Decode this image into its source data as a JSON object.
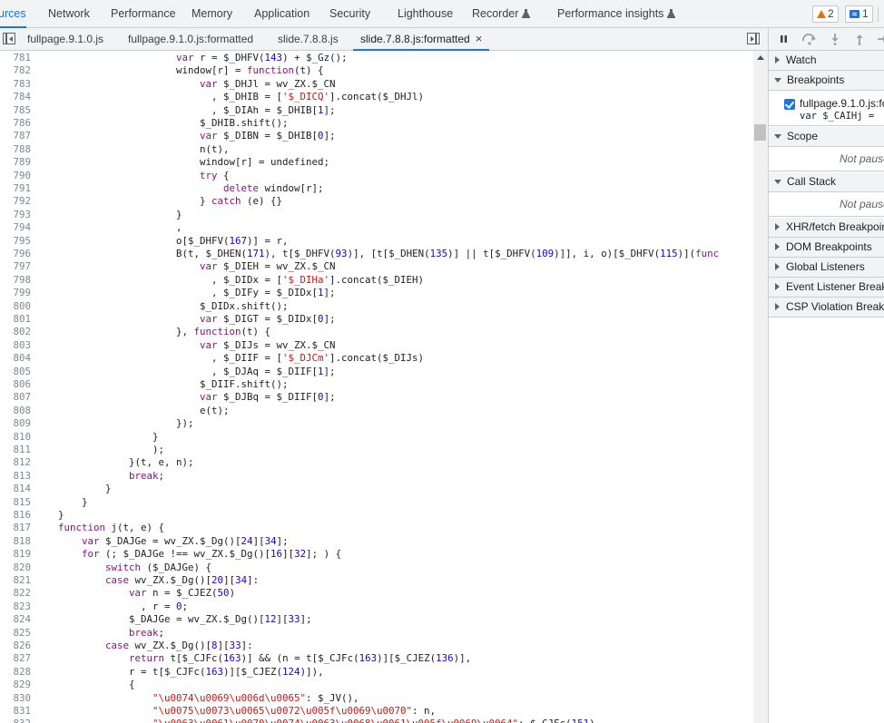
{
  "main_tabs": [
    {
      "label": "urces",
      "active": true
    },
    {
      "label": "Network"
    },
    {
      "label": "Performance"
    },
    {
      "label": "Memory"
    },
    {
      "label": "Application"
    },
    {
      "label": "Security"
    },
    {
      "label": "Lighthouse"
    },
    {
      "label": "Recorder",
      "experimental": true
    },
    {
      "label": "Performance insights",
      "experimental": true
    }
  ],
  "issues": {
    "warnings": "2",
    "messages": "1"
  },
  "file_tabs": [
    {
      "label": "fullpage.9.1.0.js"
    },
    {
      "label": "fullpage.9.1.0.js:formatted"
    },
    {
      "label": "slide.7.8.8.js"
    },
    {
      "label": "slide.7.8.8.js:formatted",
      "active": true,
      "close": "×"
    }
  ],
  "code_lines": [
    {
      "n": "781",
      "h": "                        <span class=\"kw\">var</span> r = $_DHFV(<span class=\"nm\">143</span>) + $_Gz();"
    },
    {
      "n": "782",
      "h": "                        window[r] = <span class=\"kw\">function</span>(t) {"
    },
    {
      "n": "783",
      "h": "                            <span class=\"kw\">var</span> $_DHJl = wv_ZX.$_CN"
    },
    {
      "n": "784",
      "h": "                              , $_DHIB = [<span class=\"st\">'$_DICQ'</span>].concat($_DHJl)"
    },
    {
      "n": "785",
      "h": "                              , $_DIAh = $_DHIB[<span class=\"nm\">1</span>];"
    },
    {
      "n": "786",
      "h": "                            $_DHIB.shift();"
    },
    {
      "n": "787",
      "h": "                            <span class=\"kw\">var</span> $_DIBN = $_DHIB[<span class=\"nm\">0</span>];"
    },
    {
      "n": "788",
      "h": "                            n(t),"
    },
    {
      "n": "789",
      "h": "                            window[r] = undefined;"
    },
    {
      "n": "790",
      "h": "                            <span class=\"kw\">try</span> {"
    },
    {
      "n": "791",
      "h": "                                <span class=\"kw\">delete</span> window[r];"
    },
    {
      "n": "792",
      "h": "                            } <span class=\"kw\">catch</span> (e) {}"
    },
    {
      "n": "793",
      "h": "                        }"
    },
    {
      "n": "794",
      "h": "                        ,"
    },
    {
      "n": "795",
      "h": "                        o[$_DHFV(<span class=\"nm\">167</span>)] = r,"
    },
    {
      "n": "796",
      "h": "                        B(t, $_DHEN(<span class=\"nm\">171</span>), t[$_DHFV(<span class=\"nm\">93</span>)], [t[$_DHEN(<span class=\"nm\">135</span>)] || t[$_DHFV(<span class=\"nm\">109</span>)]], i, o)[$_DHFV(<span class=\"nm\">115</span>)](<span class=\"kw\">func</span>"
    },
    {
      "n": "797",
      "h": "                            <span class=\"kw\">var</span> $_DIEH = wv_ZX.$_CN"
    },
    {
      "n": "798",
      "h": "                              , $_DIDx = [<span class=\"st\">'$_DIHa'</span>].concat($_DIEH)"
    },
    {
      "n": "799",
      "h": "                              , $_DIFy = $_DIDx[<span class=\"nm\">1</span>];"
    },
    {
      "n": "800",
      "h": "                            $_DIDx.shift();"
    },
    {
      "n": "801",
      "h": "                            <span class=\"kw\">var</span> $_DIGT = $_DIDx[<span class=\"nm\">0</span>];"
    },
    {
      "n": "802",
      "h": "                        }, <span class=\"kw\">function</span>(t) {"
    },
    {
      "n": "803",
      "h": "                            <span class=\"kw\">var</span> $_DIJs = wv_ZX.$_CN"
    },
    {
      "n": "804",
      "h": "                              , $_DIIF = [<span class=\"st\">'$_DJCm'</span>].concat($_DIJs)"
    },
    {
      "n": "805",
      "h": "                              , $_DJAq = $_DIIF[<span class=\"nm\">1</span>];"
    },
    {
      "n": "806",
      "h": "                            $_DIIF.shift();"
    },
    {
      "n": "807",
      "h": "                            <span class=\"kw\">var</span> $_DJBq = $_DIIF[<span class=\"nm\">0</span>];"
    },
    {
      "n": "808",
      "h": "                            e(t);"
    },
    {
      "n": "809",
      "h": "                        });"
    },
    {
      "n": "810",
      "h": "                    }"
    },
    {
      "n": "811",
      "h": "                    );"
    },
    {
      "n": "812",
      "h": "                }(t, e, n);"
    },
    {
      "n": "813",
      "h": "                <span class=\"kw\">break</span>;"
    },
    {
      "n": "814",
      "h": "            }"
    },
    {
      "n": "815",
      "h": "        }"
    },
    {
      "n": "816",
      "h": "    }"
    },
    {
      "n": "817",
      "h": "    <span class=\"kw\">function</span> j(t, e) {"
    },
    {
      "n": "818",
      "h": "        <span class=\"kw\">var</span> $_DAJGe = wv_ZX.$_Dg()[<span class=\"nm\">24</span>][<span class=\"nm\">34</span>];"
    },
    {
      "n": "819",
      "h": "        <span class=\"kw\">for</span> (; $_DAJGe !== wv_ZX.$_Dg()[<span class=\"nm\">16</span>][<span class=\"nm\">32</span>]; ) {"
    },
    {
      "n": "820",
      "h": "            <span class=\"kw\">switch</span> ($_DAJGe) {"
    },
    {
      "n": "821",
      "h": "            <span class=\"kw\">case</span> wv_ZX.$_Dg()[<span class=\"nm\">20</span>][<span class=\"nm\">34</span>]:"
    },
    {
      "n": "822",
      "h": "                <span class=\"kw\">var</span> n = $_CJEZ(<span class=\"nm\">50</span>)"
    },
    {
      "n": "823",
      "h": "                  , r = <span class=\"nm\">0</span>;"
    },
    {
      "n": "824",
      "h": "                $_DAJGe = wv_ZX.$_Dg()[<span class=\"nm\">12</span>][<span class=\"nm\">33</span>];"
    },
    {
      "n": "825",
      "h": "                <span class=\"kw\">break</span>;"
    },
    {
      "n": "826",
      "h": "            <span class=\"kw\">case</span> wv_ZX.$_Dg()[<span class=\"nm\">8</span>][<span class=\"nm\">33</span>]:"
    },
    {
      "n": "827",
      "h": "                <span class=\"kw\">return</span> t[$_CJFc(<span class=\"nm\">163</span>)] &amp;&amp; (n = t[$_CJFc(<span class=\"nm\">163</span>)][$_CJEZ(<span class=\"nm\">136</span>)],"
    },
    {
      "n": "828",
      "h": "                r = t[$_CJFc(<span class=\"nm\">163</span>)][$_CJEZ(<span class=\"nm\">124</span>)]),"
    },
    {
      "n": "829",
      "h": "                {"
    },
    {
      "n": "830",
      "h": "                    <span class=\"st\">\"\\u0074\\u0069\\u006d\\u0065\"</span>: $_JV(),"
    },
    {
      "n": "831",
      "h": "                    <span class=\"st\">\"\\u0075\\u0073\\u0065\\u0072\\u005f\\u0069\\u0070\"</span>: n,"
    },
    {
      "n": "832",
      "h": "                    <span class=\"st\">\"\\u0063\\u0061\\u0070\\u0074\\u0063\\u0068\\u0061\\u005f\\u0069\\u0064\"</span>: $_CJFc(<span class=\"nm\">151</span>)"
    }
  ],
  "sidebar": {
    "sections": [
      {
        "label": "Watch",
        "expanded": false
      },
      {
        "label": "Breakpoints",
        "expanded": true
      },
      {
        "label": "Scope",
        "expanded": true
      },
      {
        "label": "Call Stack",
        "expanded": true
      },
      {
        "label": "XHR/fetch Breakpoints",
        "expanded": false
      },
      {
        "label": "DOM Breakpoints",
        "expanded": false
      },
      {
        "label": "Global Listeners",
        "expanded": false
      },
      {
        "label": "Event Listener Breakpoints",
        "expanded": false
      },
      {
        "label": "CSP Violation Breakpoints",
        "expanded": false
      }
    ],
    "breakpoint": {
      "file": "fullpage.9.1.0.js:fo",
      "code": "var $_CAIHj = "
    },
    "not_paused": "Not paused"
  },
  "colors": {
    "accent": "#1a73e8",
    "keyword": "#881280",
    "string": "#c41a16",
    "number": "#1c00cf"
  }
}
